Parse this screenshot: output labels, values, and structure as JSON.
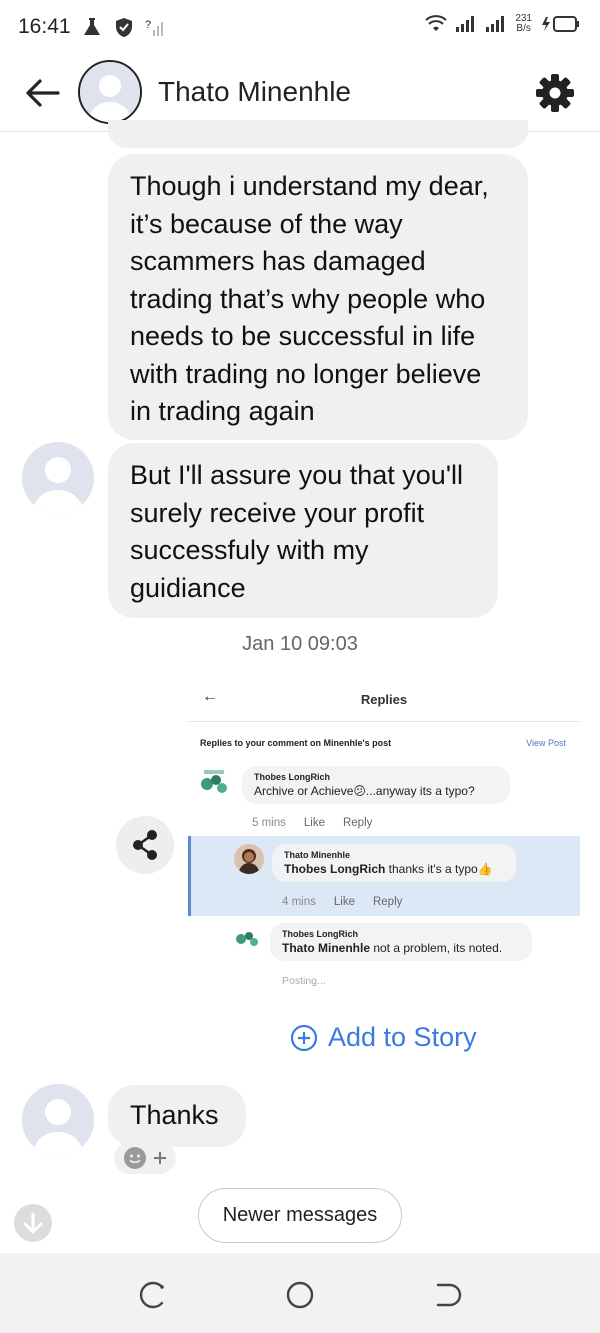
{
  "status_bar": {
    "time": "16:41",
    "net_speed_value": "231",
    "net_speed_unit": "B/s"
  },
  "header": {
    "contact_name": "Thato Minenhle"
  },
  "messages": [
    {
      "lines": [
        "Though i understand my dear,",
        "it’s because of the way",
        "scammers has damaged",
        "trading that’s why people who",
        "needs to be successful in life",
        "with trading no longer believe",
        "in trading again"
      ]
    },
    {
      "lines": [
        "But I'll assure you that you'll",
        "surely receive your profit",
        "successfuly with my",
        "guidiance"
      ]
    }
  ],
  "timestamp": "Jan 10 09:03",
  "shared_post": {
    "title": "Replies",
    "subheader": "Replies to your comment on Minenhle's post",
    "view_post": "View Post",
    "comments": [
      {
        "name": "Thobes LongRich",
        "text_pre": "Archive or Achieve",
        "text_post": "...anyway its a typo?",
        "time": "5 mins",
        "like": "Like",
        "reply": "Reply"
      },
      {
        "name": "Thato Minenhle",
        "mention": "Thobes LongRich",
        "text": " thanks it's a typo",
        "time": "4 mins",
        "like": "Like",
        "reply": "Reply"
      },
      {
        "name": "Thobes LongRich",
        "mention": "Thato Minenhle",
        "text": " not a problem, its noted.",
        "status": "Posting..."
      }
    ]
  },
  "add_to_story": "Add to Story",
  "last_message": "Thanks",
  "newer_messages": "Newer messages",
  "colors": {
    "accent_blue": "#3a7be2",
    "bubble_gray": "#f0f0f0",
    "highlight_blue": "#dce8f6"
  }
}
